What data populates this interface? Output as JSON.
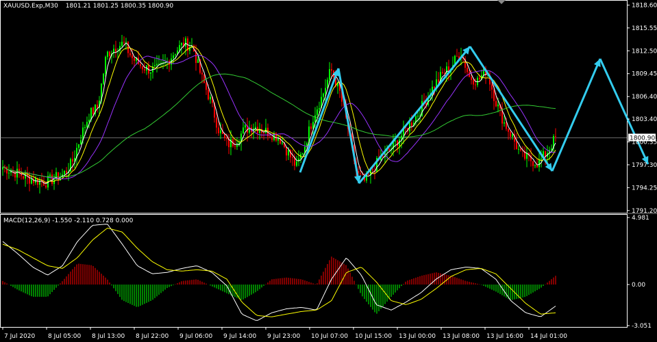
{
  "symbol_header": {
    "symbol": "XAUUSD.Exp,M30",
    "ohlc": "1801.21 1801.25 1800.35 1800.90"
  },
  "macd_header": {
    "label": "MACD(12,26,9) -1.550 -2.110 0.728 0.000"
  },
  "colors": {
    "background": "#000000",
    "bull": "#00ff00",
    "bear": "#ff0000",
    "ma_fast": "#ffffff",
    "ma_mid": "#ffff00",
    "ma_slow": "#9933ff",
    "ma_long": "#33cc33",
    "arrow": "#33ccee",
    "grid_text": "#ffffff"
  },
  "chart_data": [
    {
      "type": "candlestick",
      "title": "XAUUSD.Exp,M30",
      "ylim": [
        1791.0,
        1819.0
      ],
      "y_ticks": [
        "1818.60",
        "1815.55",
        "1812.50",
        "1809.45",
        "1806.40",
        "1803.40",
        "1800.35",
        "1797.30",
        "1794.25",
        "1791.20"
      ],
      "current_price": "1800.90",
      "x_labels": [
        "7 Jul 2020",
        "8 Jul 05:00",
        "8 Jul 13:00",
        "8 Jul 22:00",
        "9 Jul 06:00",
        "9 Jul 14:00",
        "9 Jul 23:00",
        "10 Jul 07:00",
        "10 Jul 15:00",
        "13 Jul 00:00",
        "13 Jul 08:00",
        "13 Jul 16:00",
        "14 Jul 01:00"
      ],
      "close_path": [
        1797.0,
        1796.5,
        1796.0,
        1795.5,
        1795.2,
        1795.0,
        1795.5,
        1796.0,
        1797.5,
        1801.0,
        1804.0,
        1805.0,
        1812.0,
        1813.0,
        1813.5,
        1811.5,
        1810.5,
        1810.0,
        1810.0,
        1811.0,
        1812.5,
        1813.5,
        1813.0,
        1809.0,
        1806.0,
        1802.0,
        1800.0,
        1800.5,
        1802.0,
        1802.5,
        1802.0,
        1801.5,
        1801.0,
        1799.0,
        1797.0,
        1800.0,
        1804.0,
        1806.5,
        1810.0,
        1807.0,
        1802.0,
        1796.0,
        1795.0,
        1797.0,
        1798.5,
        1799.5,
        1801.0,
        1802.5,
        1804.0,
        1806.0,
        1808.0,
        1809.5,
        1810.5,
        1812.5,
        1809.0,
        1808.5,
        1810.0,
        1806.0,
        1803.0,
        1801.0,
        1798.5,
        1798.0,
        1797.5,
        1799.0,
        1800.9
      ]
    },
    {
      "type": "line",
      "title": "MACD(12,26,9)",
      "ylim": [
        -3.051,
        4.981
      ],
      "y_ticks": [
        "4.981",
        "0.00",
        "-3.051"
      ],
      "series": [
        {
          "name": "MACD",
          "values": [
            3.2,
            2.3,
            1.3,
            0.7,
            1.4,
            3.2,
            4.4,
            4.5,
            3.0,
            1.4,
            0.8,
            0.9,
            1.2,
            1.4,
            0.9,
            -0.1,
            -2.2,
            -2.7,
            -2.1,
            -1.8,
            -1.7,
            -1.9,
            0.4,
            2.0,
            0.7,
            -1.5,
            -1.9,
            -1.3,
            -0.6,
            0.4,
            1.1,
            1.3,
            1.2,
            0.4,
            -1.2,
            -2.1,
            -2.4,
            -1.6
          ]
        },
        {
          "name": "Signal",
          "values": [
            3.0,
            2.6,
            2.0,
            1.4,
            1.2,
            2.0,
            3.3,
            4.2,
            3.9,
            2.7,
            1.7,
            1.1,
            1.0,
            1.1,
            1.0,
            0.4,
            -1.3,
            -2.3,
            -2.4,
            -2.2,
            -2.0,
            -1.9,
            -1.2,
            0.9,
            1.3,
            0.2,
            -1.2,
            -1.5,
            -1.1,
            -0.3,
            0.6,
            1.1,
            1.2,
            0.8,
            -0.3,
            -1.4,
            -2.2,
            -2.1
          ]
        }
      ]
    }
  ]
}
